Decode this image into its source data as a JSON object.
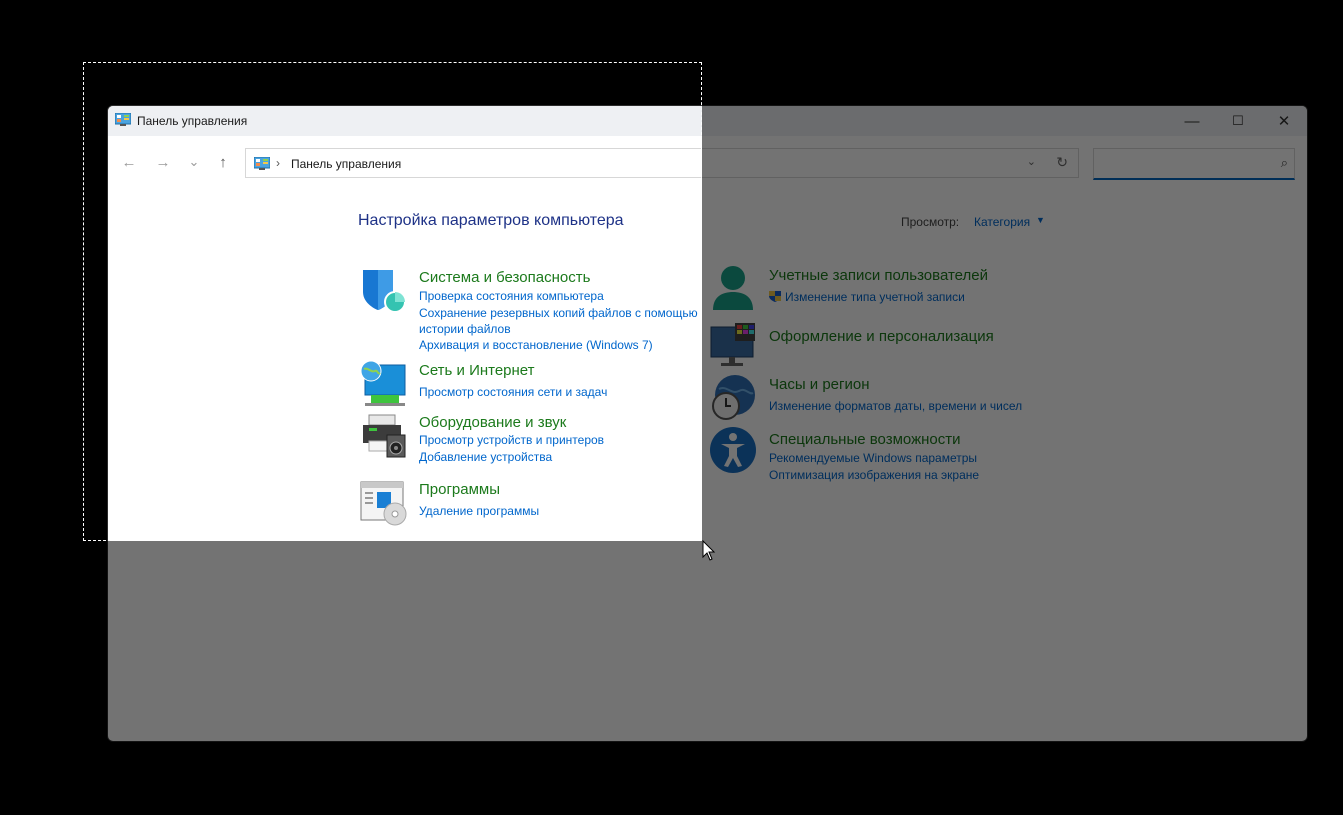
{
  "window": {
    "title": "Панель управления",
    "controls": {
      "minimize": "—",
      "maximize": "☐",
      "close": "✕"
    }
  },
  "navigation": {
    "back": "←",
    "forward": "→",
    "recent": "⌄",
    "up": "↑",
    "separator": "›",
    "address_text": "Панель управления",
    "address_dropdown": "⌄",
    "refresh": "↻",
    "search_placeholder": "",
    "search_icon": "⌕"
  },
  "main": {
    "heading": "Настройка параметров компьютера",
    "view_label": "Просмотр:",
    "view_value": "Категория",
    "view_arrow": "▼"
  },
  "categories_left": [
    {
      "title": "Система и безопасность",
      "icon": "shield-icon",
      "links": [
        "Проверка состояния компьютера",
        "Сохранение резервных копий файлов с помощью",
        "истории файлов",
        "Архивация и восстановление (Windows 7)"
      ]
    },
    {
      "title": "Сеть и Интернет",
      "icon": "network-globe-icon",
      "links": [
        "Просмотр состояния сети и задач"
      ]
    },
    {
      "title": "Оборудование и звук",
      "icon": "printer-speaker-icon",
      "links": [
        "Просмотр устройств и принтеров",
        "Добавление устройства"
      ]
    },
    {
      "title": "Программы",
      "icon": "programs-disc-icon",
      "links": [
        "Удаление программы"
      ]
    }
  ],
  "categories_right": [
    {
      "title": "Учетные записи пользователей",
      "icon": "user-icon",
      "links": [
        "Изменение типа учетной записи"
      ]
    },
    {
      "title": "Оформление и персонализация",
      "icon": "monitor-palette-icon",
      "links": []
    },
    {
      "title": "Часы и регион",
      "icon": "clock-globe-icon",
      "links": [
        "Изменение форматов даты, времени и чисел"
      ]
    },
    {
      "title": "Специальные возможности",
      "icon": "accessibility-icon",
      "links": [
        "Рекомендуемые Windows параметры",
        "Оптимизация изображения на экране"
      ]
    }
  ],
  "colors": {
    "category_title": "#1c7a1c",
    "link": "#0066cc",
    "heading": "#1e3287",
    "selection_border": "#ffffff"
  }
}
